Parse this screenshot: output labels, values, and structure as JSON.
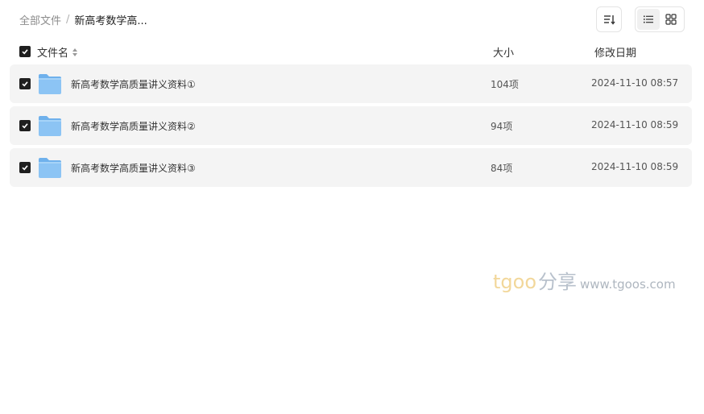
{
  "breadcrumb": {
    "root": "全部文件",
    "separator": "/",
    "current": "新高考数学高..."
  },
  "toolbar": {
    "sort_icon": "sort-icon",
    "list_icon": "list-view-icon",
    "grid_icon": "grid-view-icon",
    "active_view": "list"
  },
  "table": {
    "headers": {
      "name": "文件名",
      "size": "大小",
      "date": "修改日期"
    },
    "rows": [
      {
        "name": "新高考数学高质量讲义资料①",
        "size": "104项",
        "date": "2024-11-10 08:57",
        "checked": true
      },
      {
        "name": "新高考数学高质量讲义资料②",
        "size": "94项",
        "date": "2024-11-10 08:59",
        "checked": true
      },
      {
        "name": "新高考数学高质量讲义资料③",
        "size": "84项",
        "date": "2024-11-10 08:59",
        "checked": true
      }
    ]
  },
  "watermark": {
    "brand": "tgoo",
    "share": "分享",
    "url": "www.tgoos.com"
  },
  "colors": {
    "checkbox": "#1f1f1f",
    "row_bg": "#f4f4f4",
    "folder": "#8cc4f4"
  }
}
